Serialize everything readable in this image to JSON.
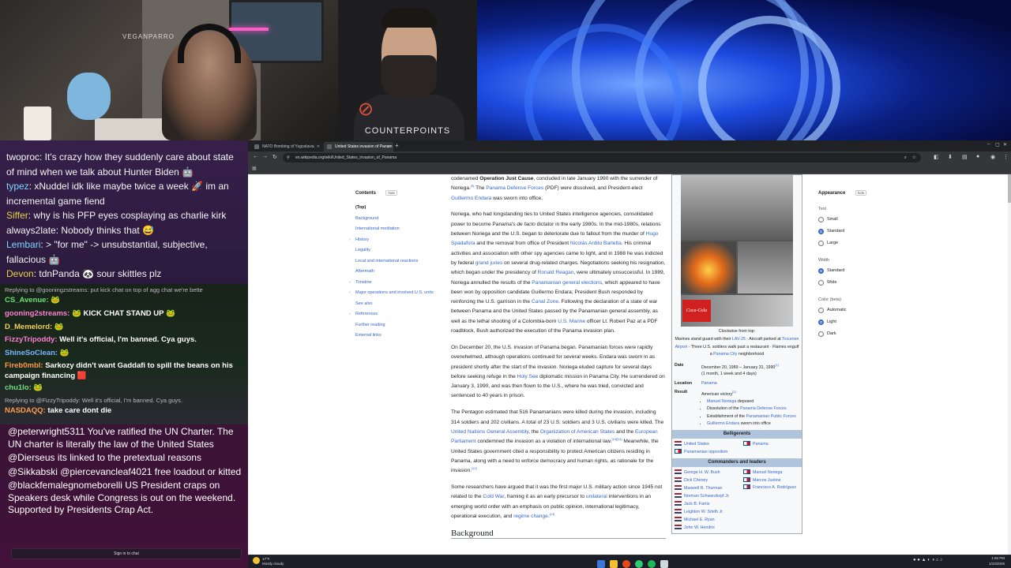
{
  "host_cam": {
    "wall_label": "VEGANPARRO"
  },
  "guest_cam": {
    "brand": "COUNTERPOINTS",
    "mic_icon": "mic-off-icon"
  },
  "chat_top": [
    {
      "user": "",
      "text": "twoproc: It's crazy how they suddenly care about state of mind when we talk about Hunter Biden 🤖"
    },
    {
      "user": "typez",
      "text": ": xNuddel idk like maybe twice a week 🚀 im an incremental game fiend"
    },
    {
      "user": "Siffer",
      "text": ": why is his PFP eyes cosplaying as charlie kirk"
    },
    {
      "user": "",
      "text": "always2late: Nobody thinks that 😅"
    },
    {
      "user": "Lembari",
      "text": ": > \"for me\" -> unsubstantial, subjective, fallacious 🤖"
    },
    {
      "user": "Devon",
      "text": ": tdnPanda 🐼 sour skittles plz"
    }
  ],
  "chat_mid": {
    "reply_1": "Replying to @gooningzstreams: put kick chat on top of agg chat we're bette",
    "messages": [
      {
        "user": "CS_Avenue:",
        "text": "🐸",
        "color": "green"
      },
      {
        "user": "gooning2streams:",
        "text": "🐸 KICK CHAT STAND UP 🐸",
        "color": "pink"
      },
      {
        "user": "D_Memelord:",
        "text": "🐸",
        "color": "gold"
      },
      {
        "user": "FizzyTripoddy:",
        "text": "Well it's official, I'm banned. Cya guys.",
        "color": "pink"
      },
      {
        "user": "ShineSoClean:",
        "text": "🐸",
        "color": "blue"
      },
      {
        "user": "Fireb0mbl:",
        "text": "Sarkozy didn't want Gaddafi to spill the beans on his campaign financing 🟥",
        "color": "orange"
      },
      {
        "user": "chu1lo:",
        "text": "🐸",
        "color": "green"
      }
    ],
    "reply_2": "Replying to @FizzyTripoddy: Well it's official, I'm banned. Cya guys.",
    "last": {
      "user": "NASDAQQ:",
      "text": "take care dont die",
      "color": "orange"
    }
  },
  "chat_bottom": {
    "messages": [
      "@peterwright5311 You've ratified the UN Charter. The UN charter is literally the law of the United States",
      "@Dierseus its linked to the pretextual reasons",
      "@Sikkabski @piercevancleaf4021 free loadout or kitted",
      "@blackfemalegnomeborelli US President craps on Speakers desk while Congress is out on the weekend. Supported by Presidents Crap Act."
    ],
    "sign_in": "Sign in to chat"
  },
  "browser": {
    "tabs": [
      {
        "label": "NATO Bombing of Yugoslavia",
        "active": false
      },
      {
        "label": "United States invasion of Panam",
        "active": true
      }
    ],
    "url": "en.wikipedia.org/wiki/United_States_invasion_of_Panama"
  },
  "toc": {
    "heading": "Contents",
    "hide": "hide",
    "items": [
      {
        "label": "(Top)",
        "top": true,
        "caret": false
      },
      {
        "label": "Background",
        "caret": false
      },
      {
        "label": "International mediation",
        "caret": false
      },
      {
        "label": "History",
        "caret": true
      },
      {
        "label": "Legality",
        "caret": false
      },
      {
        "label": "Local and international reactions",
        "caret": false
      },
      {
        "label": "Aftermath",
        "caret": false
      },
      {
        "label": "Timeline",
        "caret": true
      },
      {
        "label": "Major operations and involved U.S. units",
        "caret": true,
        "two": true
      },
      {
        "label": "See also",
        "caret": false
      },
      {
        "label": "References",
        "caret": true
      },
      {
        "label": "Further reading",
        "caret": false
      },
      {
        "label": "External links",
        "caret": false
      }
    ]
  },
  "article": {
    "p1": [
      "codenamed ",
      "Operation Just Cause",
      ", concluded in late January 1990 with the surrender of Noriega.",
      "[9]",
      " The ",
      "Panama Defense Forces",
      " (PDF) were dissolved, and President-elect ",
      "Guillermo Endara",
      " was sworn into office."
    ],
    "p2": [
      "Noriega, who had longstanding ties to United States intelligence agencies, consolidated power to become Panama's ",
      "de facto",
      " dictator in the early 1980s. In the mid-1980s, relations between Noriega and the U.S. began to deteriorate due to fallout from the murder of ",
      "Hugo Spadafora",
      " and the removal from office of President ",
      "Nicolás Ardito Barletta",
      ". His criminal activities and association with other spy agencies came to light, and in 1988 he was indicted by federal ",
      "grand juries",
      " on several drug-related charges. Negotiations seeking his resignation, which began under the presidency of ",
      "Ronald Reagan",
      ", were ultimately unsuccessful. In 1989, Noriega annulled the results of the ",
      "Panamanian general elections",
      ", which appeared to have been won by opposition candidate Guillermo Endara; President Bush responded by reinforcing the U.S. garrison in the ",
      "Canal Zone",
      ". Following the declaration of a state of war between Panama and the United States passed by the Panamanian general assembly, as well as the lethal shooting of a Colombia-born ",
      "U.S. Marine",
      " officer Lt. Robert Paz at a PDF roadblock, Bush authorized the execution of the Panama invasion plan."
    ],
    "p3": [
      "On December 20, the U.S. invasion of Panama began. Panamanian forces were rapidly overwhelmed, although operations continued for several weeks. Endara was sworn in as president shortly after the start of the invasion. Noriega eluded capture for several days before seeking refuge in the ",
      "Holy See",
      " diplomatic mission in Panama City. He surrendered on January 3, 1990, and was then flown to the U.S., where he was tried, convicted and sentenced to 40 years in prison."
    ],
    "p4": [
      "The Pentagon estimated that 516 Panamanians were killed during the invasion, including 314 soldiers and 202 civilians. A total of 23 U.S. soldiers and 3 U.S. civilians were killed. The ",
      "United Nations General Assembly",
      ", the ",
      "Organization of American States",
      " and the ",
      "European Parliament",
      " condemned the invasion as a violation of international law.",
      "[10][11]",
      " Meanwhile, the United States government cited a responsibility to protect American citizens residing in Panama, along with a need to enforce democracy and human rights, as rationale for the invasion.",
      "[12]"
    ],
    "p5": [
      "Some researchers have argued that it was the first major U.S. military action since 1945 not related to the ",
      "Cold War",
      ", framing it as an early precursor to ",
      "unilateral",
      " interventions in an emerging world order with an emphasis on public opinion, international legitimacy, operational execution, and ",
      "regime change",
      ".",
      "[13]"
    ],
    "h2": "Background"
  },
  "infobox": {
    "coke_text": "Coca-Cola",
    "caption_1": "Clockwise from top:",
    "caption_2": "Marines stand guard with their ",
    "caption_lav": "LAV-25",
    "caption_3": " · Aircraft parked at ",
    "caption_airport": "Tocumen Airport",
    "caption_4": " · Three U.S. soldiers walk past a restaurant · Flames engulf a ",
    "caption_city": "Panama City",
    "caption_5": " neighborhood",
    "date_label": "Date",
    "date_value": "December 20, 1989 – January 31, 1990",
    "date_ref": "[1]",
    "date_span": "(1 month, 1 week and 4 days)",
    "location_label": "Location",
    "location_value": "Panama",
    "result_label": "Result",
    "result_value": "American victory",
    "result_ref": "[2]",
    "results": [
      [
        "Manuel Noriega",
        " deposed"
      ],
      [
        "Dissolution of the ",
        "Panama Defense Forces"
      ],
      [
        "Establishment of the ",
        "Panamanian Public Forces"
      ],
      [
        "Guillermo Endara",
        " sworn into office"
      ]
    ],
    "belligerents_header": "Belligerents",
    "bell_us": "United States",
    "bell_pa": "Panama",
    "bell_opp": "Panamanian opposition",
    "commanders_header": "Commanders and leaders",
    "cmd_us": [
      "George H. W. Bush",
      "Dick Cheney",
      "Maxwell R. Thurman",
      "Norman Schwarzkopf Jr.",
      "Jack B. Farris",
      "Leighton W. Smith Jr.",
      "Michael E. Ryan",
      "John W. Hendrix"
    ],
    "cmd_pa": [
      "Manuel Noriega",
      "Marcos Justine",
      "Francisco A. Rodríguez"
    ]
  },
  "appearance": {
    "heading": "Appearance",
    "hide": "hide",
    "text_label": "Text",
    "text_options": [
      {
        "label": "Small",
        "on": false
      },
      {
        "label": "Standard",
        "on": true
      },
      {
        "label": "Large",
        "on": false
      }
    ],
    "width_label": "Width",
    "width_options": [
      {
        "label": "Standard",
        "on": true
      },
      {
        "label": "Wide",
        "on": false
      }
    ],
    "color_label": "Color (beta)",
    "color_options": [
      {
        "label": "Automatic",
        "on": false
      },
      {
        "label": "Light",
        "on": true
      },
      {
        "label": "Dark",
        "on": false
      }
    ]
  },
  "taskbar": {
    "temp": "17°F",
    "weather": "Mostly cloudy",
    "time": "1:55 PM",
    "date": "1/10/2026",
    "app_colors": [
      "#3a78d8",
      "#f0c030",
      "#e64a19",
      "#2ecc71",
      "#1db954",
      "#cfd8dc"
    ]
  }
}
